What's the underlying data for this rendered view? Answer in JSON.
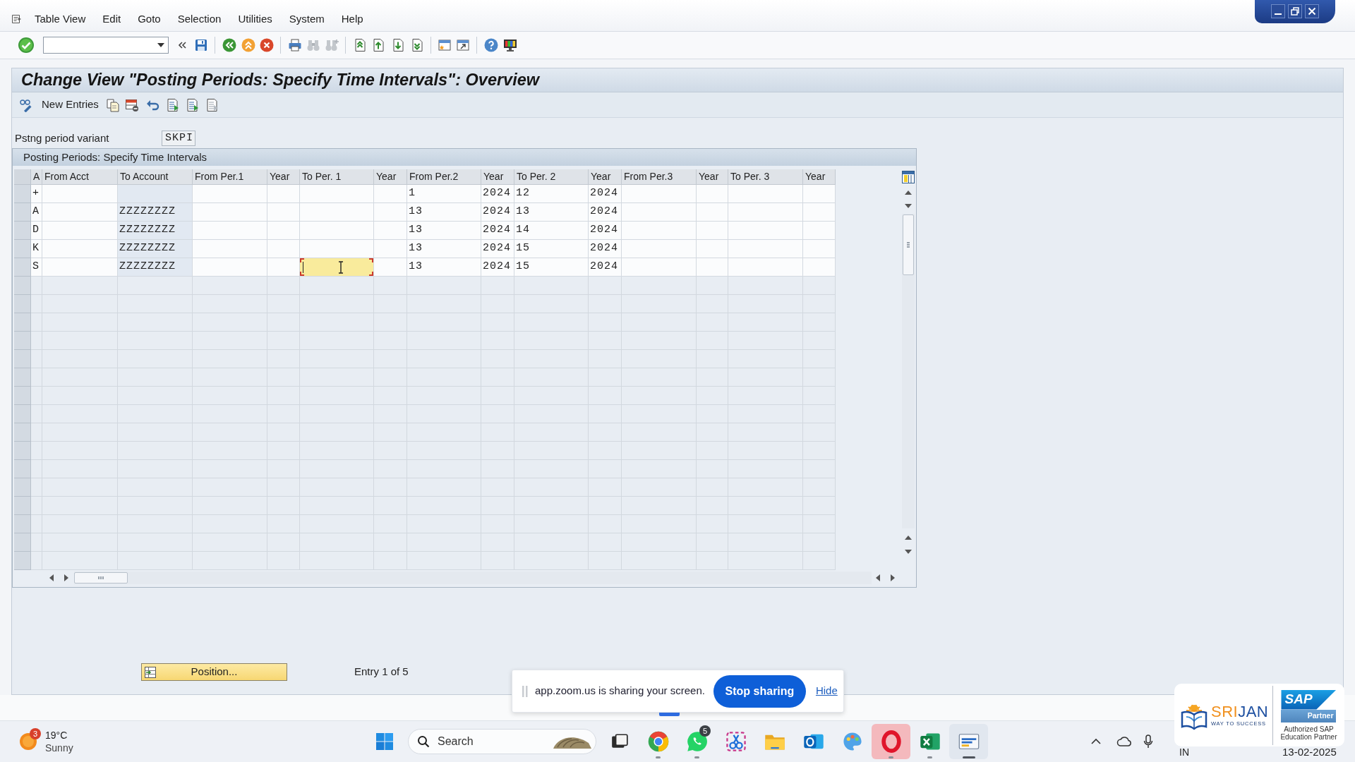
{
  "menu_bar": {
    "items": [
      "Table View",
      "Edit",
      "Goto",
      "Selection",
      "Utilities",
      "System",
      "Help"
    ]
  },
  "screen_title": "Change View \"Posting Periods: Specify Time Intervals\": Overview",
  "application_toolbar": {
    "new_entries_button": "New Entries"
  },
  "variant_field": {
    "label": "Pstng period variant",
    "value": "SKPI"
  },
  "table": {
    "title": "Posting Periods: Specify Time Intervals",
    "columns": [
      {
        "label": "A",
        "key": false
      },
      {
        "label": "From Acct",
        "key": false
      },
      {
        "label": "To Account",
        "key": true
      },
      {
        "label": "From Per.1",
        "key": false
      },
      {
        "label": "Year",
        "key": false
      },
      {
        "label": "To Per. 1",
        "key": false
      },
      {
        "label": "Year",
        "key": false
      },
      {
        "label": "From Per.2",
        "key": false
      },
      {
        "label": "Year",
        "key": false
      },
      {
        "label": "To Per. 2",
        "key": false
      },
      {
        "label": "Year",
        "key": false
      },
      {
        "label": "From Per.3",
        "key": false
      },
      {
        "label": "Year",
        "key": false
      },
      {
        "label": "To Per. 3",
        "key": false
      },
      {
        "label": "Year",
        "key": false
      }
    ],
    "rows": [
      {
        "selected": false,
        "cells": [
          {
            "text": "+",
            "selected": false
          },
          {
            "selected": false
          },
          {
            "selected": false
          },
          {
            "selected": false
          },
          {
            "selected": false
          },
          {
            "selected": false
          },
          {
            "selected": false
          },
          {
            "text": "1",
            "selected": false
          },
          {
            "text": "2024",
            "selected": false
          },
          {
            "text": "12",
            "selected": false
          },
          {
            "text": "2024",
            "selected": false
          },
          {
            "selected": false
          },
          {
            "selected": false
          },
          {
            "selected": false
          },
          {
            "selected": false
          }
        ]
      },
      {
        "selected": false,
        "cells": [
          {
            "text": "A",
            "selected": false
          },
          {
            "selected": false
          },
          {
            "text": "ZZZZZZZZ",
            "selected": false
          },
          {
            "selected": false
          },
          {
            "selected": false
          },
          {
            "selected": false
          },
          {
            "selected": false
          },
          {
            "text": "13",
            "selected": false
          },
          {
            "text": "2024",
            "selected": false
          },
          {
            "text": "13",
            "selected": false
          },
          {
            "text": "2024",
            "selected": false
          },
          {
            "selected": false
          },
          {
            "selected": false
          },
          {
            "selected": false
          },
          {
            "selected": false
          }
        ]
      },
      {
        "selected": false,
        "cells": [
          {
            "text": "D",
            "selected": false
          },
          {
            "selected": false
          },
          {
            "text": "ZZZZZZZZ",
            "selected": false
          },
          {
            "selected": false
          },
          {
            "selected": false
          },
          {
            "selected": false
          },
          {
            "selected": false
          },
          {
            "text": "13",
            "selected": false
          },
          {
            "text": "2024",
            "selected": false
          },
          {
            "text": "14",
            "selected": false
          },
          {
            "text": "2024",
            "selected": false
          },
          {
            "selected": false
          },
          {
            "selected": false
          },
          {
            "selected": false
          },
          {
            "selected": false
          }
        ]
      },
      {
        "selected": false,
        "cells": [
          {
            "text": "K",
            "selected": false
          },
          {
            "selected": false
          },
          {
            "text": "ZZZZZZZZ",
            "selected": false
          },
          {
            "selected": false
          },
          {
            "selected": false
          },
          {
            "selected": false
          },
          {
            "selected": false
          },
          {
            "text": "13",
            "selected": false
          },
          {
            "text": "2024",
            "selected": false
          },
          {
            "text": "15",
            "selected": false
          },
          {
            "text": "2024",
            "selected": false
          },
          {
            "selected": false
          },
          {
            "selected": false
          },
          {
            "selected": false
          },
          {
            "selected": false
          }
        ]
      },
      {
        "selected": false,
        "cells": [
          {
            "text": "S",
            "selected": false
          },
          {
            "selected": false
          },
          {
            "text": "ZZZZZZZZ",
            "selected": false
          },
          {
            "selected": false
          },
          {
            "selected": false
          },
          {
            "selected": true
          },
          {
            "selected": false
          },
          {
            "text": "13",
            "selected": false
          },
          {
            "text": "2024",
            "selected": false
          },
          {
            "text": "15",
            "selected": false
          },
          {
            "text": "2024",
            "selected": false
          },
          {
            "selected": false
          },
          {
            "selected": false
          },
          {
            "selected": false
          },
          {
            "selected": false
          }
        ]
      }
    ]
  },
  "position_button": "Position...",
  "entry_info": "Entry 1 of 5",
  "screen_share_bar": {
    "message": "app.zoom.us is sharing your screen.",
    "stop_button": "Stop sharing",
    "hide_link": "Hide"
  },
  "partner_logo": {
    "name_parts": [
      "SRI",
      "JAN"
    ],
    "tagline": "WAY TO SUCCESS",
    "sap_mark": "SAP",
    "sap_label": "Partner",
    "caption": [
      "Authorized SAP",
      "Education Partner"
    ]
  },
  "taskbar": {
    "weather": {
      "temperature": "19°C",
      "condition": "Sunny",
      "badge": "3"
    },
    "search": {
      "placeholder": "Search"
    },
    "apps": [
      {
        "kind": "taskview",
        "running": false,
        "focused": false,
        "flashing": false
      },
      {
        "kind": "browser",
        "running": true,
        "focused": false,
        "flashing": false
      },
      {
        "kind": "chat",
        "running": true,
        "focused": false,
        "flashing": false,
        "badge": "5"
      },
      {
        "kind": "snip",
        "running": false,
        "focused": false,
        "flashing": false
      },
      {
        "kind": "folder",
        "running": false,
        "focused": false,
        "flashing": false
      },
      {
        "kind": "mail",
        "running": false,
        "focused": false,
        "flashing": false
      },
      {
        "kind": "palette",
        "running": false,
        "focused": false,
        "flashing": false
      },
      {
        "kind": "ring",
        "running": true,
        "focused": false,
        "flashing": true
      },
      {
        "kind": "sheet",
        "running": true,
        "focused": false,
        "flashing": false
      },
      {
        "kind": "sap",
        "running": true,
        "focused": true,
        "flashing": false
      }
    ],
    "tray": {
      "language": "IN",
      "date": "13-02-2025"
    }
  }
}
